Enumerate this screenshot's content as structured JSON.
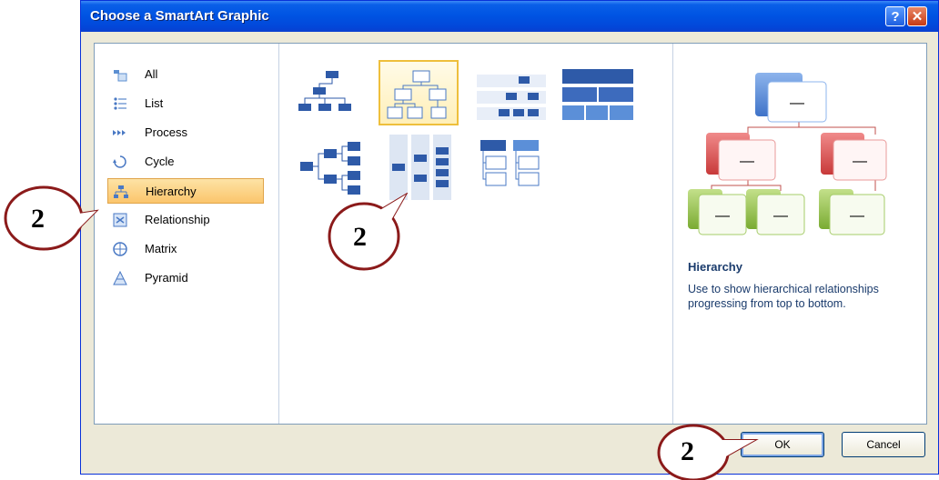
{
  "dialog": {
    "title": "Choose a SmartArt Graphic",
    "help_label": "?",
    "close_label": "✕"
  },
  "categories": [
    {
      "label": "All",
      "icon": "all-icon"
    },
    {
      "label": "List",
      "icon": "list-icon"
    },
    {
      "label": "Process",
      "icon": "process-icon"
    },
    {
      "label": "Cycle",
      "icon": "cycle-icon"
    },
    {
      "label": "Hierarchy",
      "icon": "hierarchy-icon",
      "selected": true
    },
    {
      "label": "Relationship",
      "icon": "relationship-icon"
    },
    {
      "label": "Matrix",
      "icon": "matrix-icon"
    },
    {
      "label": "Pyramid",
      "icon": "pyramid-icon"
    }
  ],
  "preview": {
    "name": "Hierarchy",
    "description": "Use to show hierarchical relationships progressing from top to bottom.",
    "box_label": "—"
  },
  "buttons": {
    "ok": "OK",
    "cancel": "Cancel"
  },
  "callouts": [
    {
      "label": "2"
    },
    {
      "label": "2"
    },
    {
      "label": "2"
    }
  ],
  "colors": {
    "accent_blue": "#0054e3",
    "selection_orange": "#fbc56c",
    "preview_blue": "#5b8fd8",
    "preview_red": "#d9534f",
    "preview_green": "#8fbf4a"
  }
}
